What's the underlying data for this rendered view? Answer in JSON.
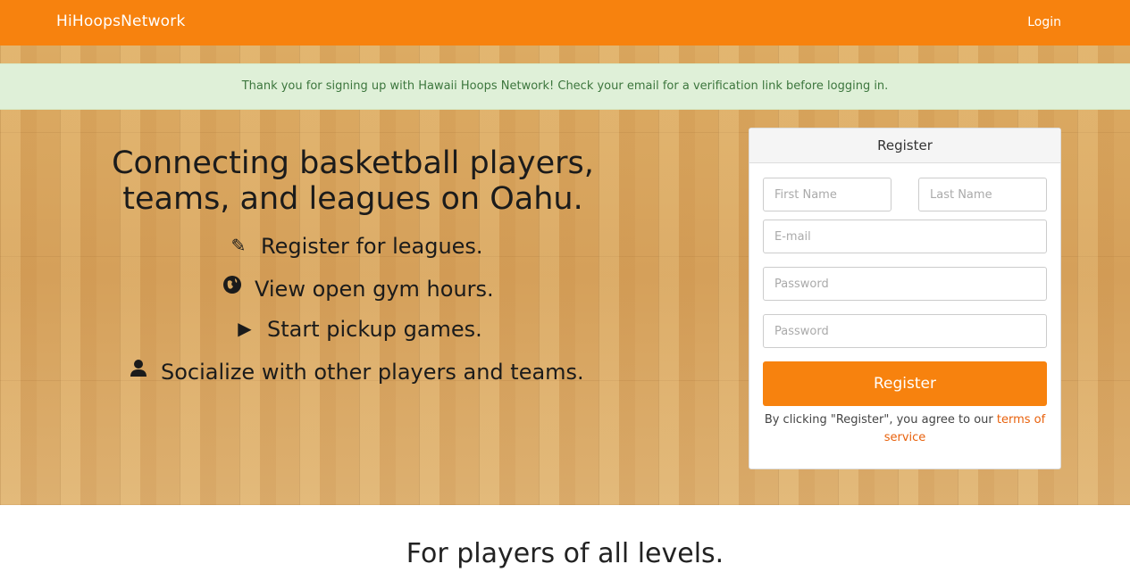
{
  "navbar": {
    "brand": "HiHoopsNetwork",
    "login": "Login",
    "color": "#f7820e"
  },
  "alert": {
    "message": "Thank you for signing up with Hawaii Hoops Network! Check your email for a verification link before logging in."
  },
  "hero": {
    "headline": "Connecting basketball players, teams, and leagues on Oahu.",
    "features": [
      {
        "icon": "pencil-icon",
        "glyph": "✎",
        "label": "Register for leagues."
      },
      {
        "icon": "globe-icon",
        "glyph": "●",
        "label": "View open gym hours."
      },
      {
        "icon": "play-icon",
        "glyph": "▶",
        "label": "Start pickup games."
      },
      {
        "icon": "user-icon",
        "glyph": "👤",
        "label": "Socialize with other players and teams."
      }
    ]
  },
  "register": {
    "title": "Register",
    "first_name_placeholder": "First Name",
    "last_name_placeholder": "Last Name",
    "email_placeholder": "E-mail",
    "password_placeholder": "Password",
    "password_confirm_placeholder": "Password",
    "button_label": "Register",
    "terms_prefix": "By clicking \"Register\", you agree to our ",
    "terms_link": "terms of service"
  },
  "section": {
    "title": "For players of all levels."
  }
}
